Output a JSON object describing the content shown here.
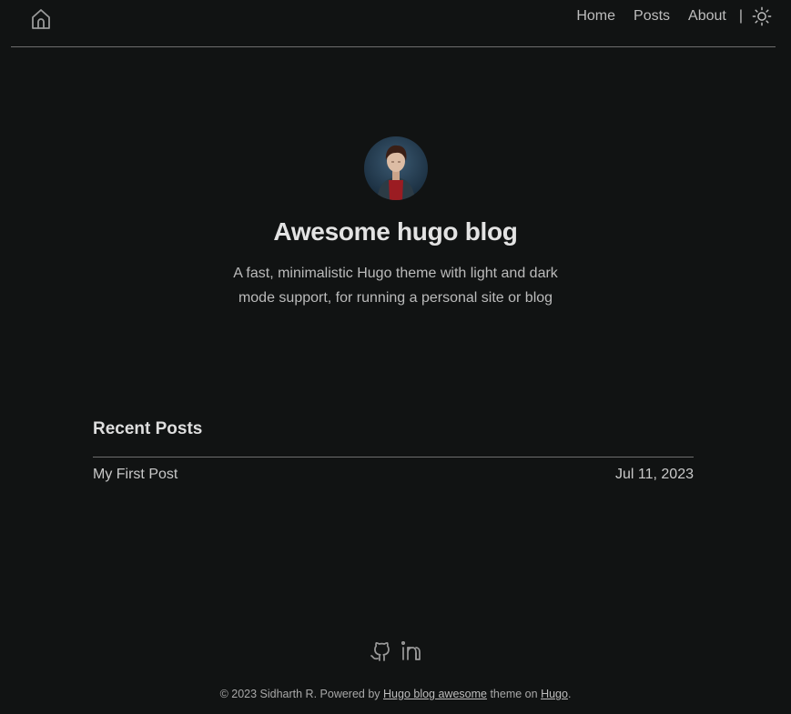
{
  "nav": {
    "home_icon": "home-icon",
    "links": [
      {
        "label": "Home"
      },
      {
        "label": "Posts"
      },
      {
        "label": "About"
      }
    ],
    "separator": "|",
    "theme_icon": "sun-icon"
  },
  "hero": {
    "title": "Awesome hugo blog",
    "description": "A fast, minimalistic Hugo theme with light and dark mode support, for running a personal site or blog"
  },
  "recent": {
    "heading": "Recent Posts",
    "posts": [
      {
        "title": "My First Post",
        "date": "Jul 11, 2023"
      }
    ]
  },
  "social": {
    "icons": [
      "github-icon",
      "linkedin-icon"
    ]
  },
  "footer": {
    "prefix": "© 2023 Sidharth R. Powered by ",
    "theme_link": "Hugo blog awesome",
    "middle": " theme on ",
    "hugo_link": "Hugo",
    "suffix": "."
  },
  "colors": {
    "background": "#111313",
    "text": "#c9c9c9",
    "heading": "#e3e3e3",
    "divider": "#6e6e6e"
  }
}
